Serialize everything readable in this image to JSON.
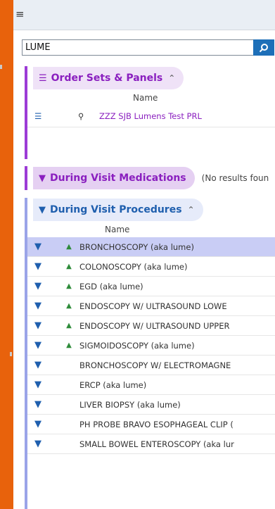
{
  "search": {
    "value": "LUME"
  },
  "order_sets": {
    "title": "Order Sets & Panels",
    "column_name": "Name",
    "rows": [
      {
        "name": "ZZZ SJB Lumens Test PRL"
      }
    ]
  },
  "medications": {
    "title": "During Visit Medications",
    "no_results": "(No results foun"
  },
  "procedures": {
    "title": "During Visit Procedures",
    "column_name": "Name",
    "rows": [
      {
        "name": "BRONCHOSCOPY (aka lume)",
        "arrow": "▲",
        "selected": true
      },
      {
        "name": "COLONOSCOPY (aka lume)",
        "arrow": "▲"
      },
      {
        "name": "EGD (aka lume)",
        "arrow": "▲"
      },
      {
        "name": "ENDOSCOPY W/ ULTRASOUND LOWE",
        "arrow": "▲"
      },
      {
        "name": "ENDOSCOPY W/ ULTRASOUND UPPER",
        "arrow": "▲"
      },
      {
        "name": "SIGMOIDOSCOPY (aka lume)",
        "arrow": "▲"
      },
      {
        "name": "BRONCHOSCOPY W/ ELECTROMAGNE",
        "arrow": ""
      },
      {
        "name": "ERCP (aka lume)",
        "arrow": ""
      },
      {
        "name": "LIVER BIOPSY (aka lume)",
        "arrow": ""
      },
      {
        "name": "PH PROBE BRAVO ESOPHAGEAL CLIP (",
        "arrow": ""
      },
      {
        "name": "SMALL BOWEL ENTEROSCOPY (aka lur",
        "arrow": ""
      }
    ]
  },
  "icons": {
    "menu": "list-menu-icon",
    "search": "magnifier-icon",
    "order_set": "order-set-icon",
    "procedure": "procedure-bed-icon",
    "collapse": "double-chevron-up-icon",
    "preview": "preview-magnifier-icon"
  },
  "colors": {
    "accent_purple": "#8a1fbf",
    "accent_blue": "#1f5fae",
    "search_button": "#1d6fb8",
    "selected_row": "#c9cdf5",
    "background": "#e8620c"
  }
}
